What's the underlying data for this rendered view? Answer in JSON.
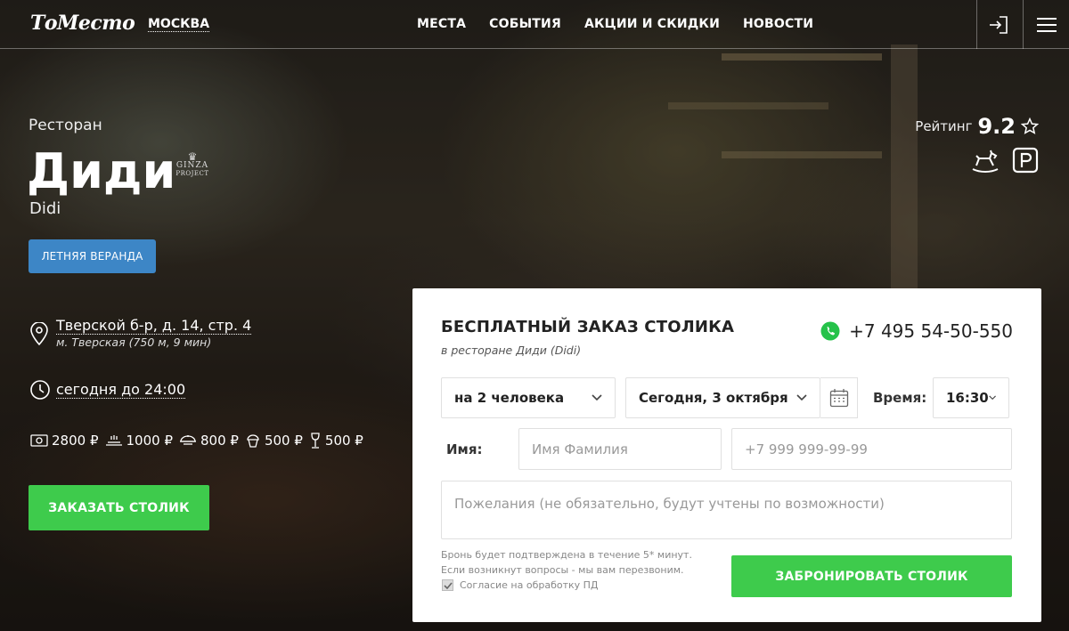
{
  "header": {
    "logo": "ТоМесто",
    "city": "МОСКВА",
    "nav": [
      "МЕСТА",
      "СОБЫТИЯ",
      "АКЦИИ И СКИДКИ",
      "НОВОСТИ"
    ]
  },
  "venue": {
    "type": "Ресторан",
    "name": "Диди",
    "latin_name": "Didi",
    "brand_logo": "GINZA PROJECT",
    "tag": "ЛЕТНЯЯ ВЕРАНДА",
    "address": "Тверской б-р, д. 14, стр. 4",
    "metro": "м. Тверская (750 м, 9 мин)",
    "hours": "сегодня до 24:00",
    "prices": [
      {
        "icon": "bill-icon",
        "value": "2800 ₽"
      },
      {
        "icon": "business-lunch-icon",
        "value": "1000 ₽"
      },
      {
        "icon": "hot-dish-icon",
        "value": "800 ₽"
      },
      {
        "icon": "dessert-icon",
        "value": "500 ₽"
      },
      {
        "icon": "wine-glass-icon",
        "value": "500 ₽"
      }
    ],
    "order_button": "ЗАКАЗАТЬ СТОЛИК",
    "rating_label": "Рейтинг",
    "rating_value": "9.2",
    "features": [
      "kids-rocking-horse-icon",
      "parking-icon"
    ]
  },
  "booking": {
    "title": "БЕСПЛАТНЫЙ ЗАКАЗ СТОЛИКА",
    "subtitle": "в ресторане Диди (Didi)",
    "phone": "+7 495 54-50-550",
    "guests": "на 2 человека",
    "date": "Сегодня, 3 октября",
    "time_label": "Время:",
    "time": "16:30",
    "name_label": "Имя:",
    "name_placeholder": "Имя Фамилия",
    "phone_placeholder": "+7 999 999-99-99",
    "wishes_placeholder": "Пожелания (не обязательно, будут учтены по возможности)",
    "note_line1": "Бронь будет подтверждена в течение 5* минут.",
    "note_line2": "Если возникнут вопросы - мы вам перезвоним.",
    "consent": "Согласие на обработку ПД",
    "submit": "ЗАБРОНИРОВАТЬ СТОЛИК"
  },
  "colors": {
    "accent_green": "#3ecb4c",
    "tag_blue": "#3d86c6",
    "whatsapp_green": "#25c24a"
  }
}
